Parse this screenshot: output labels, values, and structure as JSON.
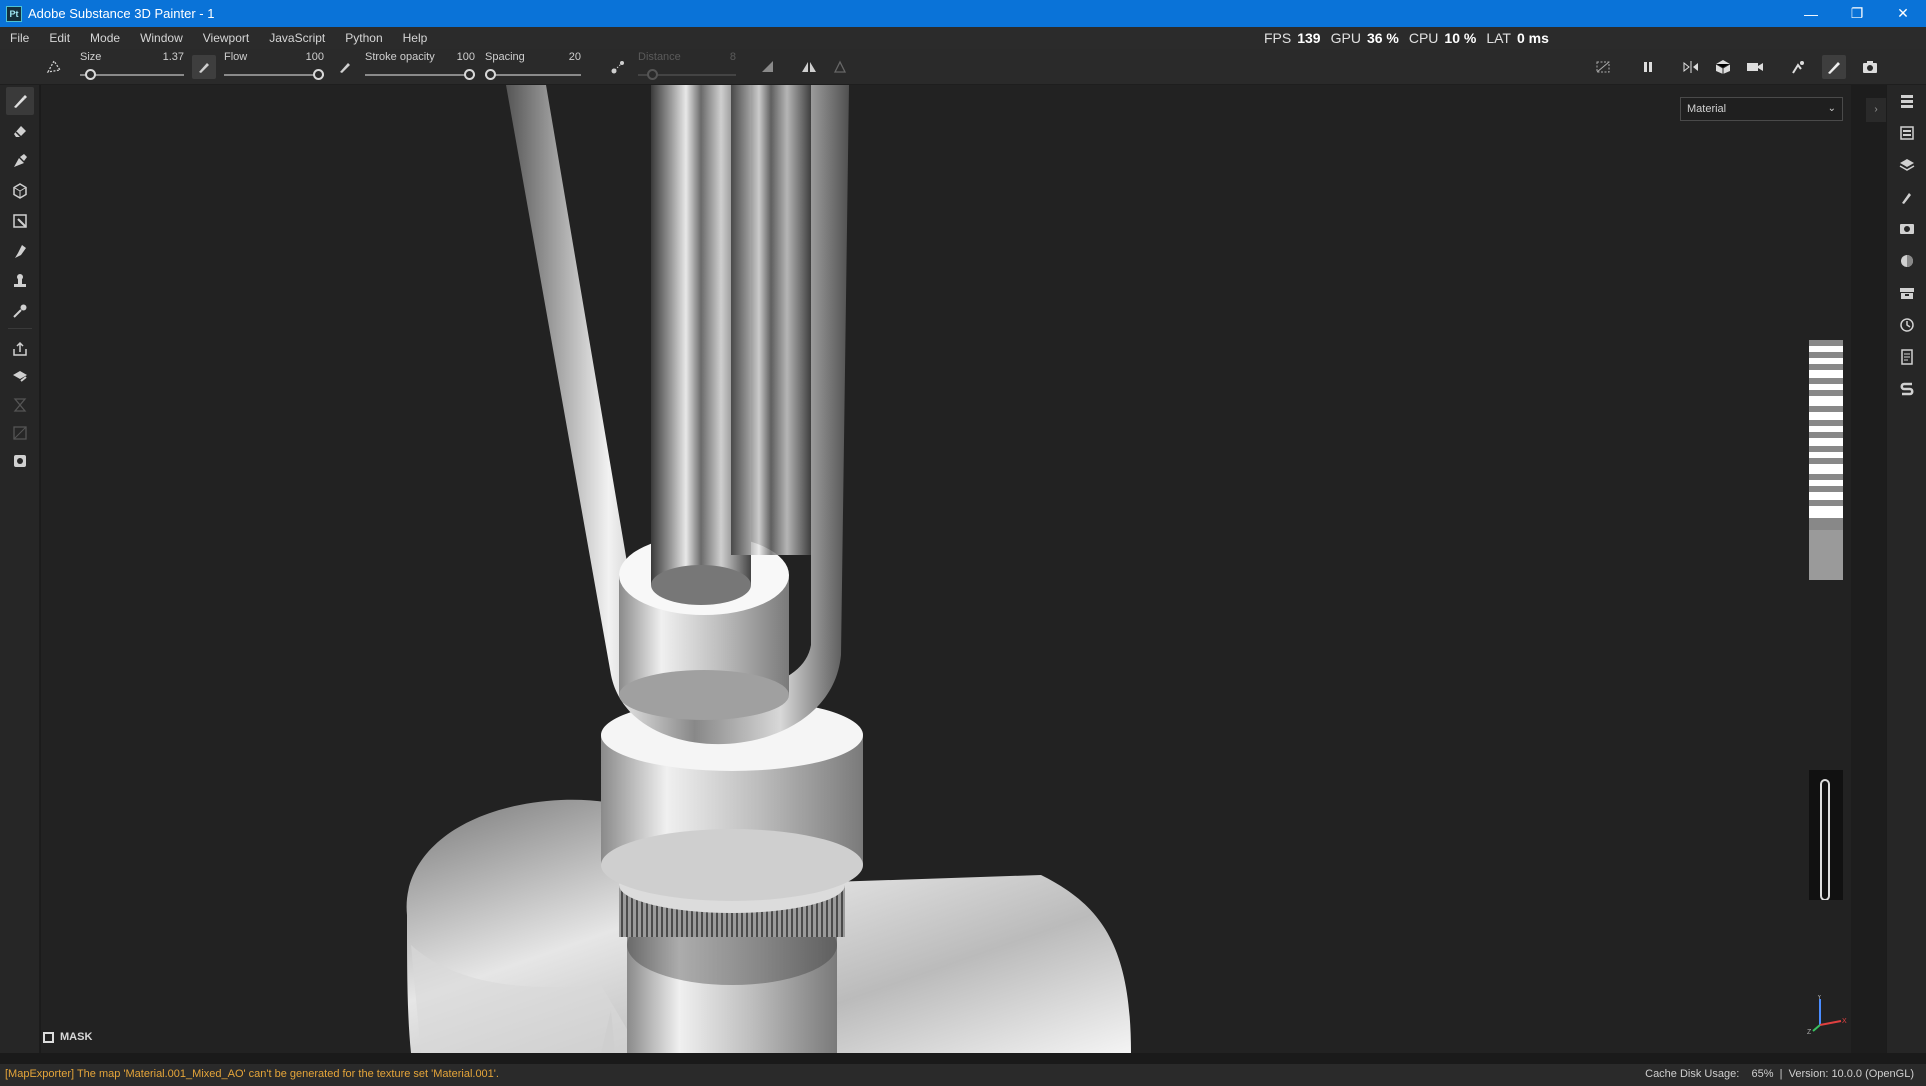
{
  "window": {
    "title": "Adobe Substance 3D Painter - 1",
    "app_icon": "Pt",
    "controls": [
      "minimize-icon",
      "restore-icon",
      "close-icon"
    ]
  },
  "menu": [
    "File",
    "Edit",
    "Mode",
    "Window",
    "Viewport",
    "JavaScript",
    "Python",
    "Help"
  ],
  "perf": {
    "fps_label": "FPS",
    "fps": "139",
    "gpu_label": "GPU",
    "gpu": "36 %",
    "cpu_label": "CPU",
    "cpu": "10 %",
    "lat_label": "LAT",
    "lat": "0 ms"
  },
  "tool_props": {
    "size": {
      "label": "Size",
      "value": "1.37",
      "fraction": 0.05
    },
    "flow": {
      "label": "Flow",
      "value": "100",
      "fraction": 1.0
    },
    "stroke_opacity": {
      "label": "Stroke opacity",
      "value": "100",
      "fraction": 1.0
    },
    "spacing": {
      "label": "Spacing",
      "value": "20",
      "fraction": 0.0
    },
    "distance": {
      "label": "Distance",
      "value": "8",
      "fraction": 0.1,
      "disabled": true
    }
  },
  "viewport": {
    "mode_select": "Material",
    "mask_label": "MASK",
    "gizmo_axes": [
      "Y",
      "X",
      "Z"
    ]
  },
  "status": {
    "message": "[MapExporter] The map 'Material.001_Mixed_AO' can't be generated for the texture set 'Material.001'.",
    "cache_label": "Cache Disk Usage:",
    "cache_value": "65%",
    "version": "Version: 10.0.0 (OpenGL)"
  },
  "colors": {
    "titlebar": "#0a73d8",
    "warning_text": "#e5a53a",
    "panel": "#2a2a2a",
    "viewport_bg": "#222222"
  }
}
